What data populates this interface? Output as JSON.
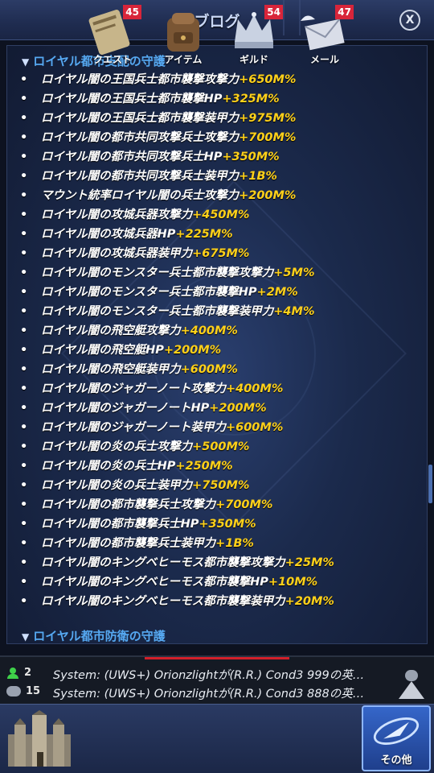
{
  "header": {
    "title": "ブログ",
    "close_label": "X"
  },
  "sections": [
    {
      "title": "ロイヤル都市支配の守護"
    },
    {
      "title": "ロイヤル都市防衛の守護"
    }
  ],
  "items": [
    {
      "name": "ロイヤル闇の王国兵士都市襲撃攻撃力",
      "value": "+650M%"
    },
    {
      "name": "ロイヤル闇の王国兵士都市襲撃HP",
      "value": "+325M%"
    },
    {
      "name": "ロイヤル闇の王国兵士都市襲撃装甲力",
      "value": "+975M%"
    },
    {
      "name": "ロイヤル闇の都市共同攻撃兵士攻撃力",
      "value": "+700M%"
    },
    {
      "name": "ロイヤル闇の都市共同攻撃兵士HP",
      "value": "+350M%"
    },
    {
      "name": "ロイヤル闇の都市共同攻撃兵士装甲力",
      "value": "+1B%"
    },
    {
      "name": "マウント統率ロイヤル闇の兵士攻撃力",
      "value": "+200M%"
    },
    {
      "name": "ロイヤル闇の攻城兵器攻撃力",
      "value": "+450M%"
    },
    {
      "name": "ロイヤル闇の攻城兵器HP",
      "value": "+225M%"
    },
    {
      "name": "ロイヤル闇の攻城兵器装甲力",
      "value": "+675M%"
    },
    {
      "name": "ロイヤル闇のモンスター兵士都市襲撃攻撃力",
      "value": "+5M%"
    },
    {
      "name": "ロイヤル闇のモンスター兵士都市襲撃HP",
      "value": "+2M%"
    },
    {
      "name": "ロイヤル闇のモンスター兵士都市襲撃装甲力",
      "value": "+4M%"
    },
    {
      "name": "ロイヤル闇の飛空艇攻撃力",
      "value": "+400M%"
    },
    {
      "name": "ロイヤル闇の飛空艇HP",
      "value": "+200M%"
    },
    {
      "name": "ロイヤル闇の飛空艇装甲力",
      "value": "+600M%"
    },
    {
      "name": "ロイヤル闇のジャガーノート攻撃力",
      "value": "+400M%"
    },
    {
      "name": "ロイヤル闇のジャガーノートHP",
      "value": "+200M%"
    },
    {
      "name": "ロイヤル闇のジャガーノート装甲力",
      "value": "+600M%"
    },
    {
      "name": "ロイヤル闇の炎の兵士攻撃力",
      "value": "+500M%"
    },
    {
      "name": "ロイヤル闇の炎の兵士HP",
      "value": "+250M%"
    },
    {
      "name": "ロイヤル闇の炎の兵士装甲力",
      "value": "+750M%"
    },
    {
      "name": "ロイヤル闇の都市襲撃兵士攻撃力",
      "value": "+700M%"
    },
    {
      "name": "ロイヤル闇の都市襲撃兵士HP",
      "value": "+350M%"
    },
    {
      "name": "ロイヤル闇の都市襲撃兵士装甲力",
      "value": "+1B%"
    },
    {
      "name": "ロイヤル闇のキングベヒーモス都市襲撃攻撃力",
      "value": "+25M%"
    },
    {
      "name": "ロイヤル闇のキングベヒーモス都市襲撃HP",
      "value": "+10M%"
    },
    {
      "name": "ロイヤル闇のキングベヒーモス都市襲撃装甲力",
      "value": "+20M%"
    }
  ],
  "chat": {
    "online_count": "2",
    "message_count": "15",
    "lines": [
      "System: (UWS+) Orionzlightが(R.R.) Cond3 999の英…",
      "System: (UWS+) Orionzlightが(R.R.) Cond3 888の英…"
    ]
  },
  "nav": {
    "items": [
      {
        "label": "クエスト",
        "badge": "45"
      },
      {
        "label": "アイテム",
        "badge": ""
      },
      {
        "label": "ギルド",
        "badge": "54"
      },
      {
        "label": "メール",
        "badge": "47"
      },
      {
        "label": "その他",
        "badge": ""
      }
    ]
  },
  "colors": {
    "section": "#56a9f2",
    "value": "#ffd11a",
    "accent": "#3566c9",
    "badge": "#d8253a"
  }
}
